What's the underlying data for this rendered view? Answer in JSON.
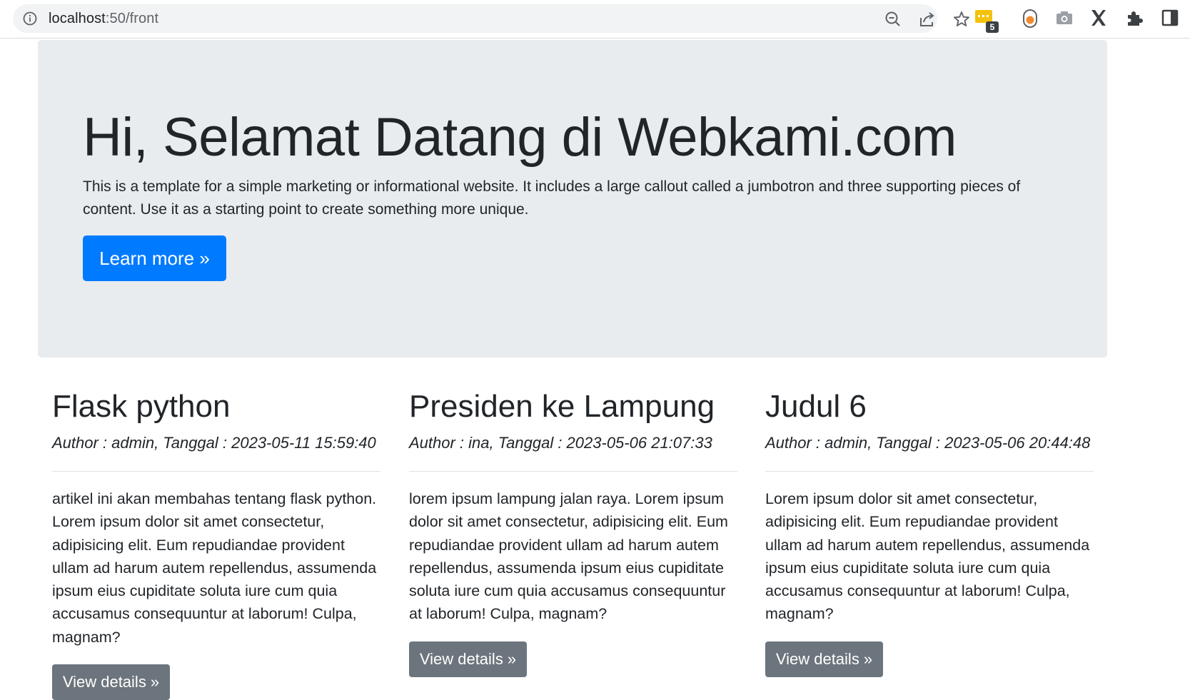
{
  "browser": {
    "url_host": "localhost",
    "url_path": ":50/front",
    "extension_badge": "5"
  },
  "icons": {
    "info": "info-icon",
    "zoom": "zoom-out-icon",
    "share": "share-icon",
    "bookmark": "star-icon",
    "ext1": "chat-extension-icon",
    "ext2": "record-extension-icon",
    "ext3": "camera-extension-icon",
    "ext4": "x-extension-icon",
    "extensions": "puzzle-icon",
    "sidepanel": "side-panel-icon"
  },
  "jumbotron": {
    "title": "Hi, Selamat Datang di Webkami.com",
    "text": "This is a template for a simple marketing or informational website. It includes a large callout called a jumbotron and three supporting pieces of content. Use it as a starting point to create something more unique.",
    "button": "Learn more »"
  },
  "articles": [
    {
      "title": "Flask python",
      "meta": "Author : admin, Tanggal : 2023-05-11 15:59:40",
      "body": "artikel ini akan membahas tentang flask python. Lorem ipsum dolor sit amet consectetur, adipisicing elit. Eum repudiandae provident ullam ad harum autem repellendus, assumenda ipsum eius cupiditate soluta iure cum quia accusamus consequuntur at laborum! Culpa, magnam?",
      "button": "View details »"
    },
    {
      "title": "Presiden ke Lampung",
      "meta": "Author : ina, Tanggal : 2023-05-06 21:07:33",
      "body": "lorem ipsum lampung jalan raya. Lorem ipsum dolor sit amet consectetur, adipisicing elit. Eum repudiandae provident ullam ad harum autem repellendus, assumenda ipsum eius cupiditate soluta iure cum quia accusamus consequuntur at laborum! Culpa, magnam?",
      "button": "View details »"
    },
    {
      "title": "Judul 6",
      "meta": "Author : admin, Tanggal : 2023-05-06 20:44:48",
      "body": "Lorem ipsum dolor sit amet consectetur, adipisicing elit. Eum repudiandae provident ullam ad harum autem repellendus, assumenda ipsum eius cupiditate soluta iure cum quia accusamus consequuntur at laborum! Culpa, magnam?",
      "button": "View details »"
    }
  ],
  "colors": {
    "primary": "#007bff",
    "secondary": "#6c757d",
    "jumbotron_bg": "#e9ecef",
    "text": "#212529"
  }
}
